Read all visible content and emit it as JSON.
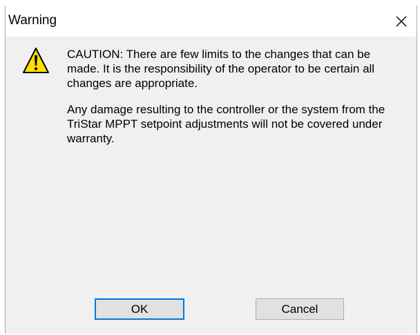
{
  "window": {
    "title": "Warning",
    "close_glyph": "✕",
    "icon": "warning-triangle-icon"
  },
  "message": {
    "paragraph1": "CAUTION: There are few limits to the changes that can be made.  It is the responsibility of the operator to be certain all changes are appropriate.",
    "paragraph2": "Any damage resulting to the controller or the system from the TriStar MPPT setpoint adjustments will not be covered under warranty."
  },
  "buttons": {
    "ok_label": "OK",
    "cancel_label": "Cancel"
  },
  "colors": {
    "warning_yellow": "#ffe000",
    "focus_border": "#0078d7",
    "dialog_bg": "#f0f0f0"
  }
}
